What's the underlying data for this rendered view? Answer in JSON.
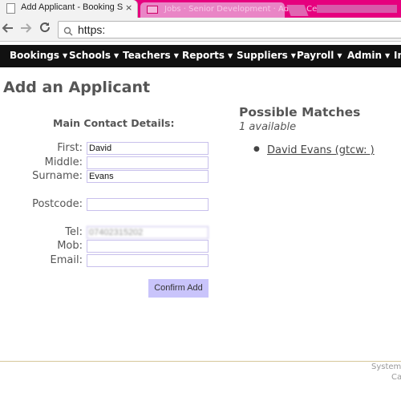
{
  "browser": {
    "active_tab_title": "Add Applicant - Booking S",
    "close_glyph": "×",
    "inactive_tab_title": "Jobs · Senior Development · Admin Centre",
    "url": "https:"
  },
  "menu": {
    "items": [
      "Bookings",
      "Schools",
      "Teachers",
      "Reports",
      "Suppliers",
      "Payroll",
      "Admin",
      "In"
    ],
    "caret": "▼"
  },
  "page": {
    "title": "Add an Applicant"
  },
  "form": {
    "section_title": "Main Contact Details:",
    "fields": {
      "first": {
        "label": "First:",
        "value": "David"
      },
      "middle": {
        "label": "Middle:",
        "value": ""
      },
      "surname": {
        "label": "Surname:",
        "value": "Evans"
      },
      "postcode": {
        "label": "Postcode:",
        "value": ""
      },
      "tel": {
        "label": "Tel:",
        "value": "07402315202"
      },
      "mob": {
        "label": "Mob:",
        "value": ""
      },
      "email": {
        "label": "Email:",
        "value": ""
      }
    },
    "confirm_label": "Confirm Add"
  },
  "matches": {
    "title": "Possible Matches",
    "count": "1 available",
    "items": [
      "David Evans (gtcw: )"
    ]
  },
  "footer": {
    "line1": "System",
    "line2": "Ca"
  },
  "colors": {
    "brand_tab": "#e6007e",
    "menubar": "#111111",
    "button": "#c9c4fb",
    "field_border": "#c8c0ec"
  }
}
